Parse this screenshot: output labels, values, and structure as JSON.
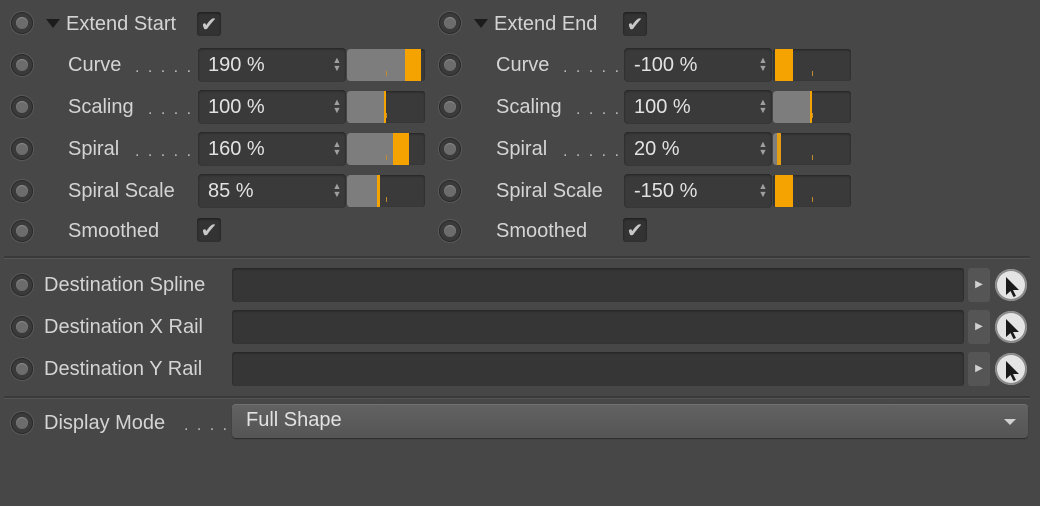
{
  "colors": {
    "accent": "#f5a300",
    "background": "#474747"
  },
  "left": {
    "header": {
      "label": "Extend Start",
      "checked": true
    },
    "rows": [
      {
        "label": "Curve",
        "value": "190 %",
        "slider": 1.9
      },
      {
        "label": "Scaling",
        "value": "100 %",
        "slider": 1.0
      },
      {
        "label": "Spiral",
        "value": "160 %",
        "slider": 1.6
      },
      {
        "label": "Spiral Scale",
        "value": "85 %",
        "slider": 0.85
      }
    ],
    "smoothed": {
      "label": "Smoothed",
      "checked": true
    }
  },
  "right": {
    "header": {
      "label": "Extend End",
      "checked": true
    },
    "rows": [
      {
        "label": "Curve",
        "value": "-100 %",
        "slider": -1.0
      },
      {
        "label": "Scaling",
        "value": "100 %",
        "slider": 1.0
      },
      {
        "label": "Spiral",
        "value": "20 %",
        "slider": 0.2
      },
      {
        "label": "Spiral Scale",
        "value": "-150 %",
        "slider": -1.5
      }
    ],
    "smoothed": {
      "label": "Smoothed",
      "checked": true
    }
  },
  "links": [
    {
      "label": "Destination Spline",
      "icon": "arrow-pick-icon"
    },
    {
      "label": "Destination X Rail",
      "icon": "arrow-pick-icon"
    },
    {
      "label": "Destination Y Rail",
      "icon": "arrow-pick-icon"
    }
  ],
  "display_mode": {
    "label": "Display Mode",
    "value": "Full Shape"
  },
  "glyphs": {
    "check": "✔",
    "dots": ". . . .",
    "dots_long": ". . . . .",
    "spin_up": "▲",
    "spin_down": "▼",
    "arrow_right": "▶",
    "cursor": "➤"
  }
}
